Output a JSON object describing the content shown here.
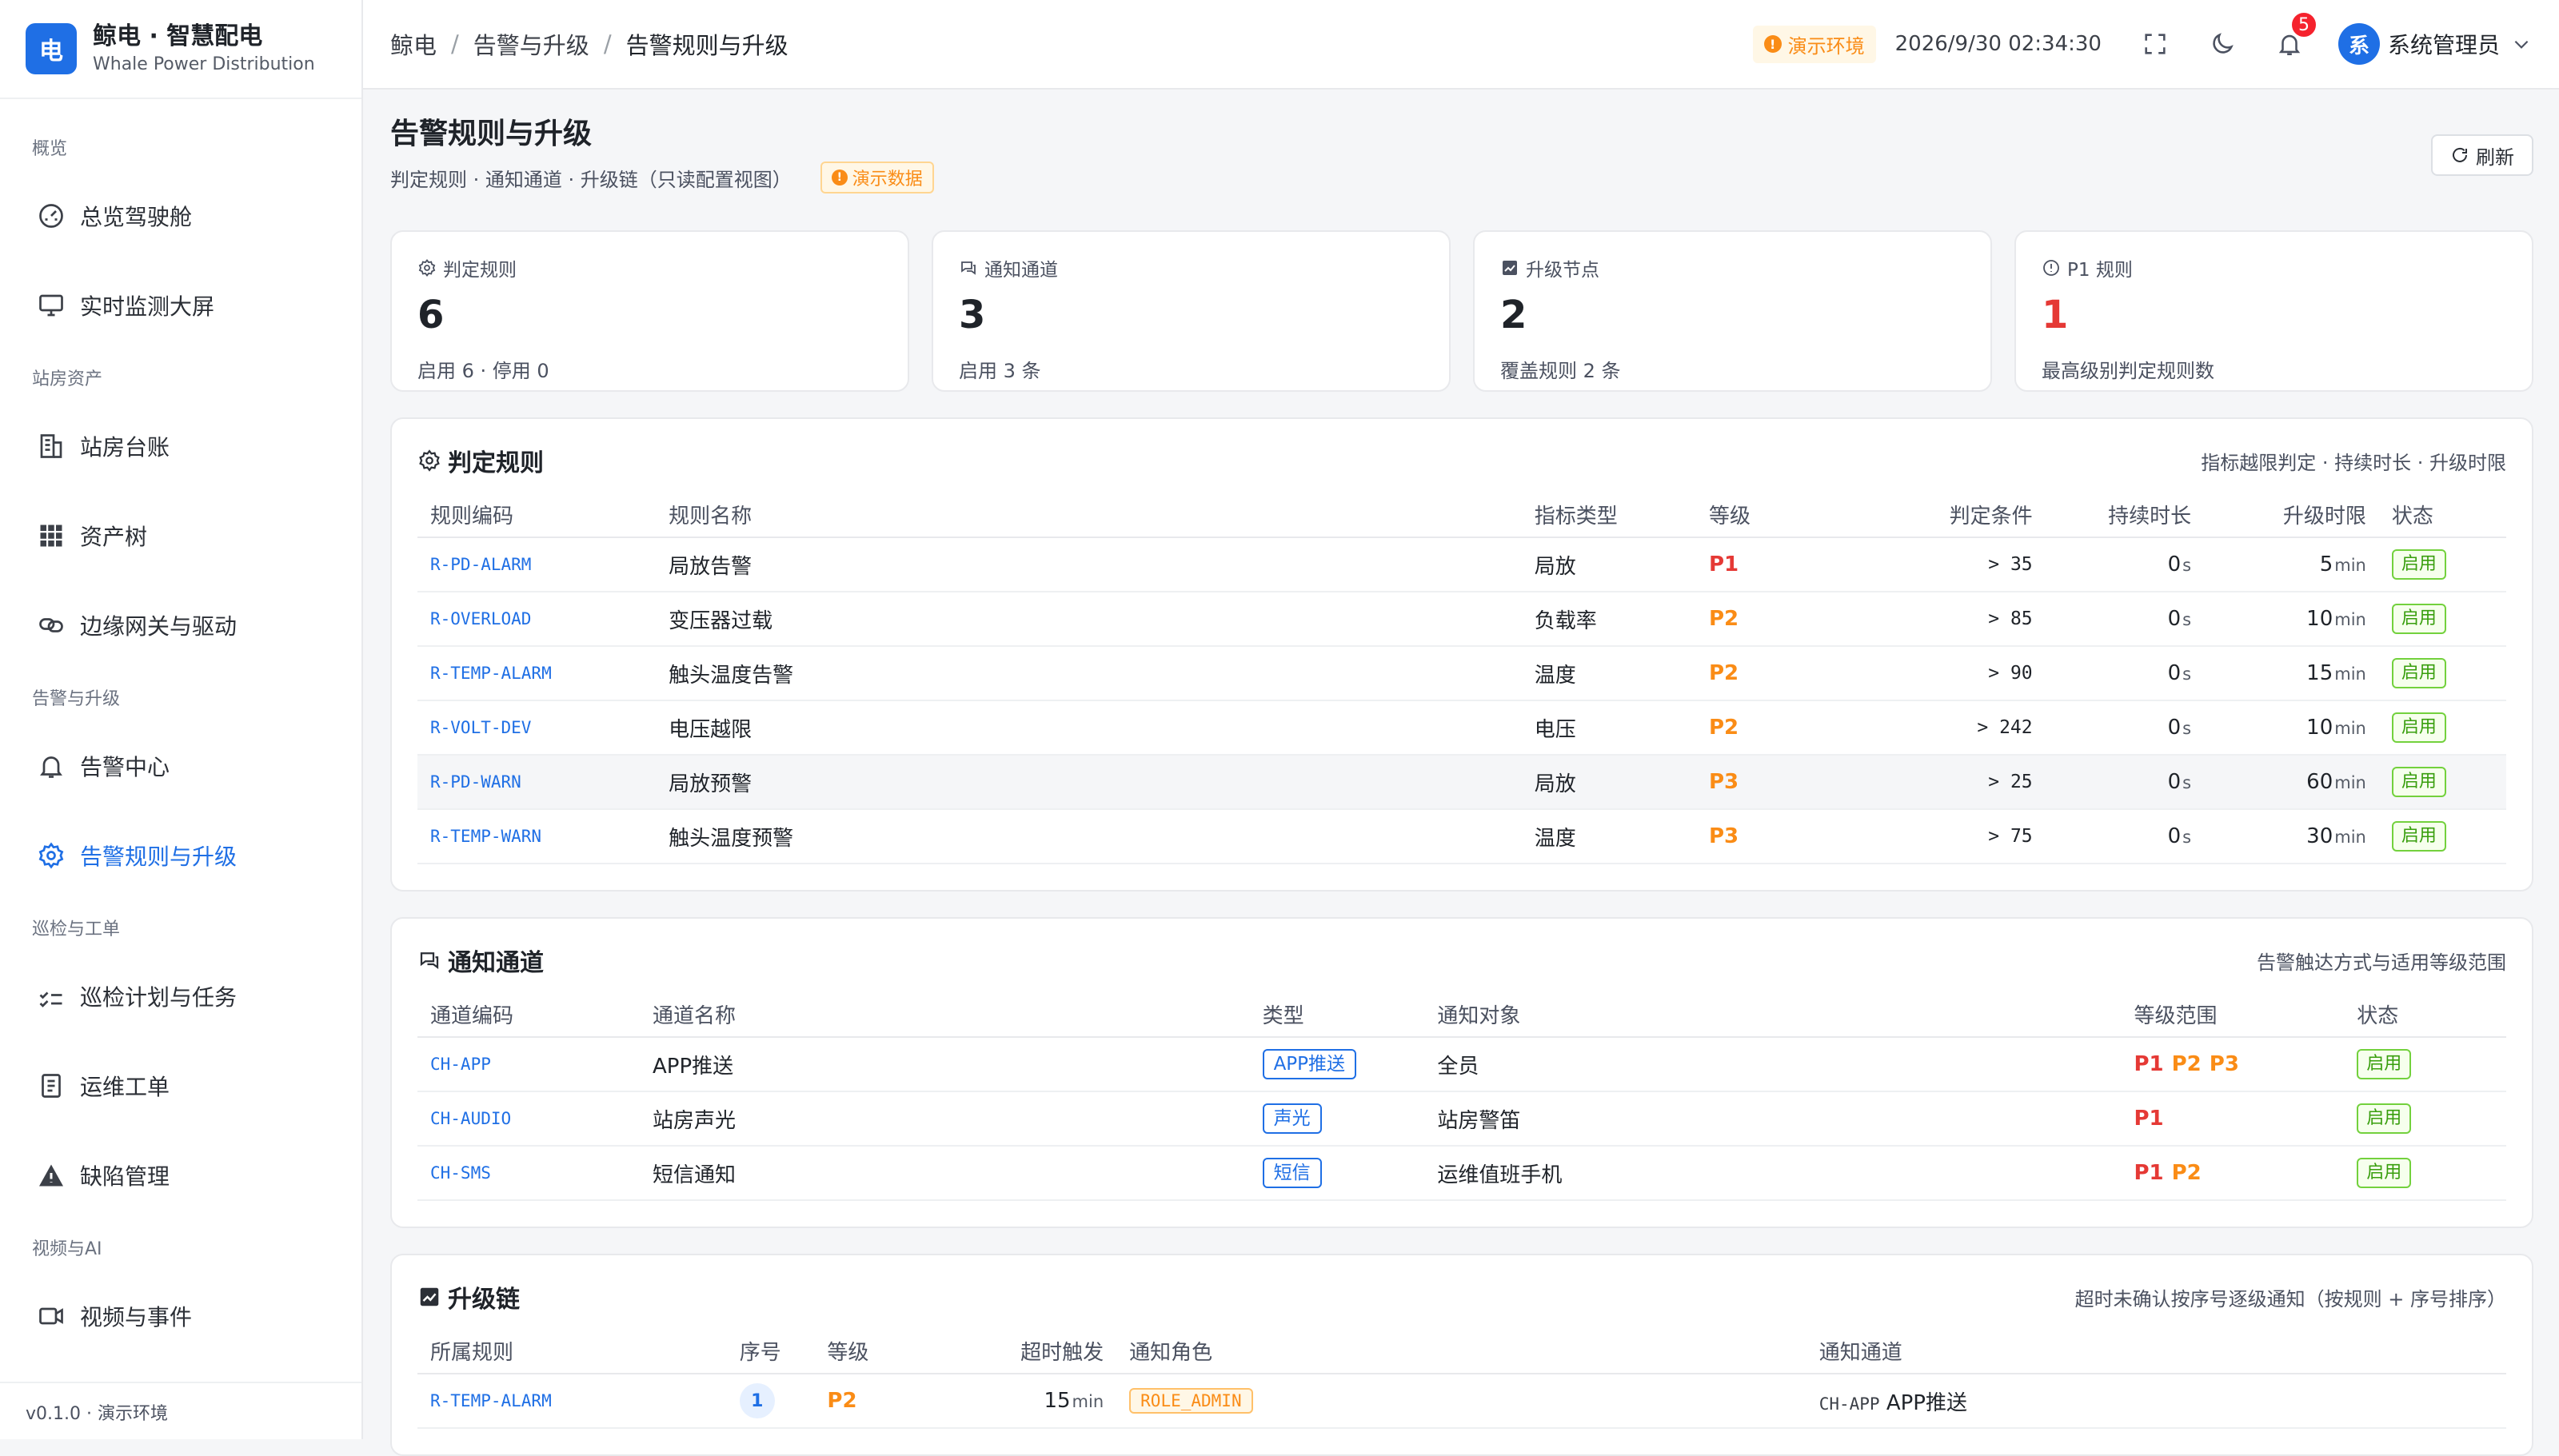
{
  "app": {
    "logo_char": "电",
    "title": "鲸电 · 智慧配电",
    "subtitle": "Whale Power Distribution",
    "version": "v0.1.0 · 演示环境"
  },
  "sidebar": {
    "groups": [
      {
        "label": "概览",
        "items": [
          {
            "label": "总览驾驶舱",
            "icon": "gauge-icon"
          },
          {
            "label": "实时监测大屏",
            "icon": "monitor-icon"
          }
        ]
      },
      {
        "label": "站房资产",
        "items": [
          {
            "label": "站房台账",
            "icon": "building-icon"
          },
          {
            "label": "资产树",
            "icon": "grid-icon"
          },
          {
            "label": "边缘网关与驱动",
            "icon": "link-icon"
          }
        ]
      },
      {
        "label": "告警与升级",
        "items": [
          {
            "label": "告警中心",
            "icon": "bell-icon"
          },
          {
            "label": "告警规则与升级",
            "icon": "gear-icon",
            "active": true
          }
        ]
      },
      {
        "label": "巡检与工单",
        "items": [
          {
            "label": "巡检计划与任务",
            "icon": "checklist-icon"
          },
          {
            "label": "运维工单",
            "icon": "document-icon"
          },
          {
            "label": "缺陷管理",
            "icon": "warning-icon"
          }
        ]
      },
      {
        "label": "视频与AI",
        "items": [
          {
            "label": "视频与事件",
            "icon": "camera-icon"
          }
        ]
      }
    ]
  },
  "header": {
    "breadcrumb": [
      "鲸电",
      "告警与升级",
      "告警规则与升级"
    ],
    "env_tag": "演示环境",
    "datetime": "2026/9/30 02:34:30",
    "notification_count": "5",
    "user_avatar": "系",
    "user_name": "系统管理员"
  },
  "page": {
    "title": "告警规则与升级",
    "subtitle": "判定规则 · 通知通道 · 升级链（只读配置视图）",
    "demo_tag": "演示数据",
    "refresh_label": "刷新"
  },
  "stats": [
    {
      "label": "判定规则",
      "value": "6",
      "foot": "启用 6 · 停用 0",
      "icon": "gear-icon"
    },
    {
      "label": "通知通道",
      "value": "3",
      "foot": "启用 3 条",
      "icon": "chat-icon"
    },
    {
      "label": "升级节点",
      "value": "2",
      "foot": "覆盖规则 2 条",
      "icon": "chart-icon"
    },
    {
      "label": "P1 规则",
      "value": "1",
      "foot": "最高级别判定规则数",
      "icon": "info-icon",
      "red": true
    }
  ],
  "rules": {
    "title": "判定规则",
    "desc": "指标越限判定 · 持续时长 · 升级时限",
    "columns": [
      "规则编码",
      "规则名称",
      "指标类型",
      "等级",
      "判定条件",
      "持续时长",
      "升级时限",
      "状态"
    ],
    "rows": [
      {
        "code": "R-PD-ALARM",
        "name": "局放告警",
        "metric": "局放",
        "level": "P1",
        "cond": "> 35",
        "dur": "0",
        "dur_unit": "s",
        "esc": "5",
        "esc_unit": "min",
        "status": "启用"
      },
      {
        "code": "R-OVERLOAD",
        "name": "变压器过载",
        "metric": "负载率",
        "level": "P2",
        "cond": "> 85",
        "dur": "0",
        "dur_unit": "s",
        "esc": "10",
        "esc_unit": "min",
        "status": "启用"
      },
      {
        "code": "R-TEMP-ALARM",
        "name": "触头温度告警",
        "metric": "温度",
        "level": "P2",
        "cond": "> 90",
        "dur": "0",
        "dur_unit": "s",
        "esc": "15",
        "esc_unit": "min",
        "status": "启用"
      },
      {
        "code": "R-VOLT-DEV",
        "name": "电压越限",
        "metric": "电压",
        "level": "P2",
        "cond": "> 242",
        "dur": "0",
        "dur_unit": "s",
        "esc": "10",
        "esc_unit": "min",
        "status": "启用"
      },
      {
        "code": "R-PD-WARN",
        "name": "局放预警",
        "metric": "局放",
        "level": "P3",
        "cond": "> 25",
        "dur": "0",
        "dur_unit": "s",
        "esc": "60",
        "esc_unit": "min",
        "status": "启用"
      },
      {
        "code": "R-TEMP-WARN",
        "name": "触头温度预警",
        "metric": "温度",
        "level": "P3",
        "cond": "> 75",
        "dur": "0",
        "dur_unit": "s",
        "esc": "30",
        "esc_unit": "min",
        "status": "启用"
      }
    ]
  },
  "channels": {
    "title": "通知通道",
    "desc": "告警触达方式与适用等级范围",
    "columns": [
      "通道编码",
      "通道名称",
      "类型",
      "通知对象",
      "等级范围",
      "状态"
    ],
    "rows": [
      {
        "code": "CH-APP",
        "name": "APP推送",
        "type": "APP推送",
        "target": "全员",
        "levels": [
          "P1",
          "P2",
          "P3"
        ],
        "status": "启用"
      },
      {
        "code": "CH-AUDIO",
        "name": "站房声光",
        "type": "声光",
        "target": "站房警笛",
        "levels": [
          "P1"
        ],
        "status": "启用"
      },
      {
        "code": "CH-SMS",
        "name": "短信通知",
        "type": "短信",
        "target": "运维值班手机",
        "levels": [
          "P1",
          "P2"
        ],
        "status": "启用"
      }
    ]
  },
  "escalation": {
    "title": "升级链",
    "desc": "超时未确认按序号逐级通知（按规则 + 序号排序）",
    "columns": [
      "所属规则",
      "序号",
      "等级",
      "超时触发",
      "通知角色",
      "通知通道"
    ],
    "rows": [
      {
        "rule": "R-TEMP-ALARM",
        "seq": "1",
        "level": "P2",
        "timeout": "15",
        "timeout_unit": "min",
        "role": "ROLE_ADMIN",
        "channel_code": "CH-APP",
        "channel_name": "APP推送"
      }
    ]
  },
  "colors": {
    "primary": "#1f6fe5",
    "p1": "#e53935",
    "p2": "#fa8c16",
    "ok": "#389e0d",
    "warn": "#fa8c16"
  }
}
